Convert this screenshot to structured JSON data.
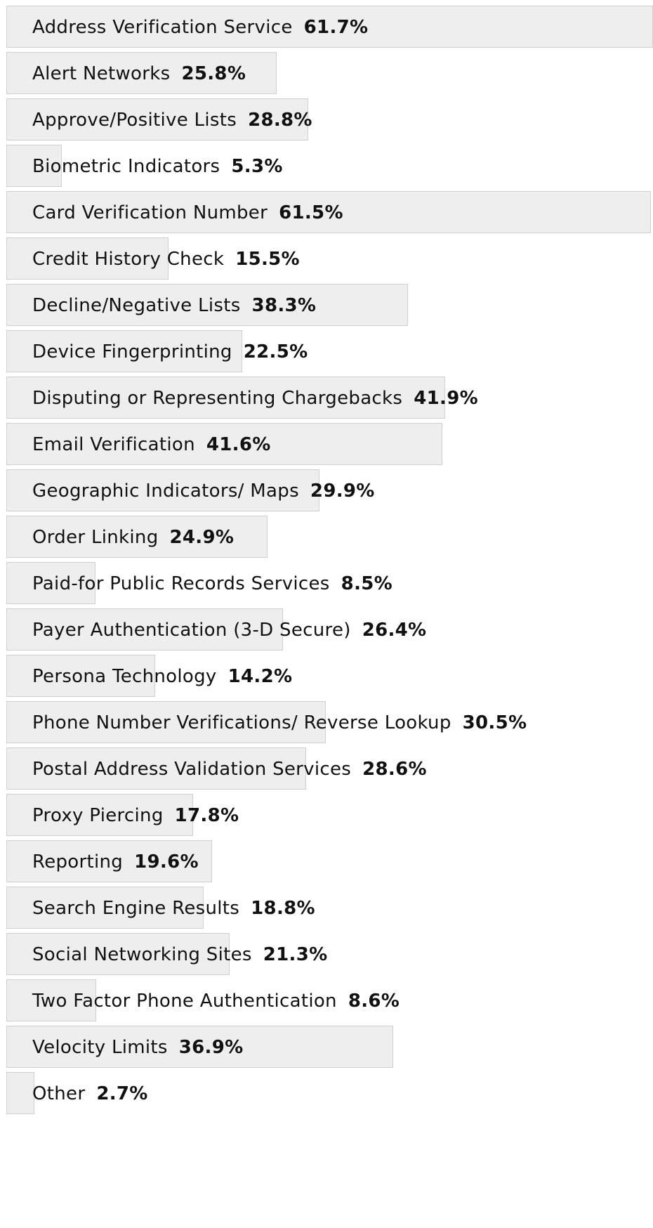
{
  "chart_data": {
    "type": "bar",
    "orientation": "horizontal",
    "value_suffix": "%",
    "colors": {
      "bar_fill": "#eeeeee",
      "bar_border": "#cfcfcf",
      "text": "#111111"
    },
    "categories": [
      "Address Verification Service",
      "Alert Networks",
      "Approve/Positive Lists",
      "Biometric Indicators",
      "Card Verification Number",
      "Credit History Check",
      "Decline/Negative Lists",
      "Device Fingerprinting",
      "Disputing or Representing Chargebacks",
      "Email Verification",
      "Geographic Indicators/ Maps",
      "Order Linking",
      "Paid-for Public Records Services",
      "Payer Authentication (3-D Secure)",
      "Persona Technology",
      "Phone Number Verifications/ Reverse Lookup",
      "Postal Address Validation Services",
      "Proxy Piercing",
      "Reporting",
      "Search Engine Results",
      "Social Networking Sites",
      "Two Factor Phone Authentication",
      "Velocity Limits",
      "Other"
    ],
    "values": [
      61.7,
      25.8,
      28.8,
      5.3,
      61.5,
      15.5,
      38.3,
      22.5,
      41.9,
      41.6,
      29.9,
      24.9,
      8.5,
      26.4,
      14.2,
      30.5,
      28.6,
      17.8,
      19.6,
      18.8,
      21.3,
      8.6,
      36.9,
      2.7
    ],
    "value_labels": [
      "61.7%",
      "25.8%",
      "28.8%",
      "5.3%",
      "61.5%",
      "15.5%",
      "38.3%",
      "22.5%",
      "41.9%",
      "41.6%",
      "29.9%",
      "24.9%",
      "8.5%",
      "26.4%",
      "14.2%",
      "30.5%",
      "28.6%",
      "17.8%",
      "19.6%",
      "18.8%",
      "21.3%",
      "8.6%",
      "36.9%",
      "2.7%"
    ],
    "xlim": [
      0,
      61.7
    ],
    "grid": false,
    "legend": "none"
  }
}
